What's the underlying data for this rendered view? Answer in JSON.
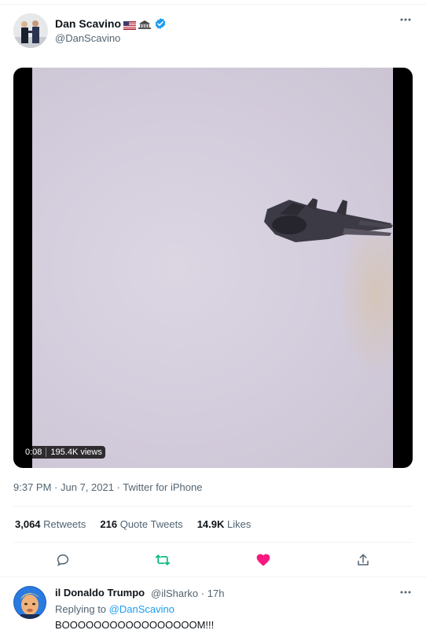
{
  "author": {
    "name": "Dan Scavino",
    "handle": "@DanScavino"
  },
  "media": {
    "duration": "0:08",
    "views": "195.4K views"
  },
  "meta": {
    "time": "9:37 PM",
    "date": "Jun 7, 2021",
    "source": "Twitter for iPhone"
  },
  "stats": {
    "retweets_count": "3,064",
    "retweets_label": "Retweets",
    "quotes_count": "216",
    "quotes_label": "Quote Tweets",
    "likes_count": "14.9K",
    "likes_label": "Likes"
  },
  "reply": {
    "name": "il Donaldo Trumpo",
    "handle": "@ilSharko",
    "time": "17h",
    "replying_prefix": "Replying to",
    "replying_to": "@DanScavino",
    "text": "BOOOOOOOOOOOOOOOOOM!!!"
  },
  "colors": {
    "accent": "#1d9bf0",
    "retweet": "#00ba7c",
    "like": "#f91880"
  },
  "icons": {
    "reply": "reply-icon",
    "retweet": "retweet-icon",
    "like": "heart-icon",
    "share": "share-icon",
    "more": "more-icon",
    "verified": "verified-badge-icon"
  }
}
